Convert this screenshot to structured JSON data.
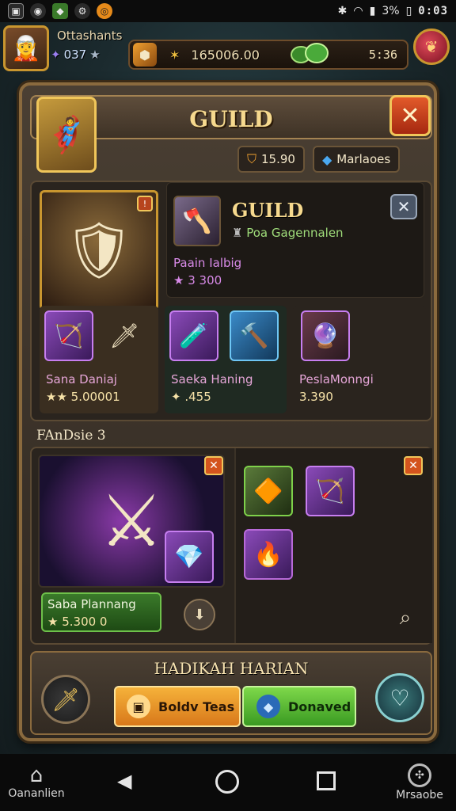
{
  "status_bar": {
    "time": "0:03",
    "battery": "3%"
  },
  "hud": {
    "player_name": "Ottashants",
    "player_level": "037",
    "gold": "165006.00",
    "energy": "5:36"
  },
  "panel": {
    "title": "GUILD",
    "chips": [
      {
        "icon": "shield-icon",
        "label": "15.90"
      },
      {
        "icon": "gem-icon",
        "label": "Marlaoes"
      }
    ],
    "guild_card": {
      "title": "GUILD",
      "subtitle": "Poa Gagennalen",
      "item_name": "Paain Ialbig",
      "item_price": "★ 3 300"
    },
    "groups": [
      {
        "name": "Sana Daniaj",
        "price": "★★ 5.00001"
      },
      {
        "name": "Saeka Haning",
        "price": "✦ .455"
      },
      {
        "name": "PeslaMonngi",
        "price": "3.390"
      }
    ],
    "section2_label": "FAnDsie 3",
    "featured": {
      "name": "Saba Plannang",
      "price": "★ 5.300 0"
    },
    "bottom": {
      "title": "HADIKAH HARIAN",
      "orange_button": "Boldv Teas",
      "green_button": "Donaved"
    }
  },
  "navbar": {
    "home_label": "Oananlien",
    "right_label": "Mrsaobe"
  },
  "colors": {
    "accent_gold": "#f6d98e",
    "close_red": "#e25a2a",
    "orange_button": "#f5b23a",
    "green_button": "#7ed84a"
  }
}
